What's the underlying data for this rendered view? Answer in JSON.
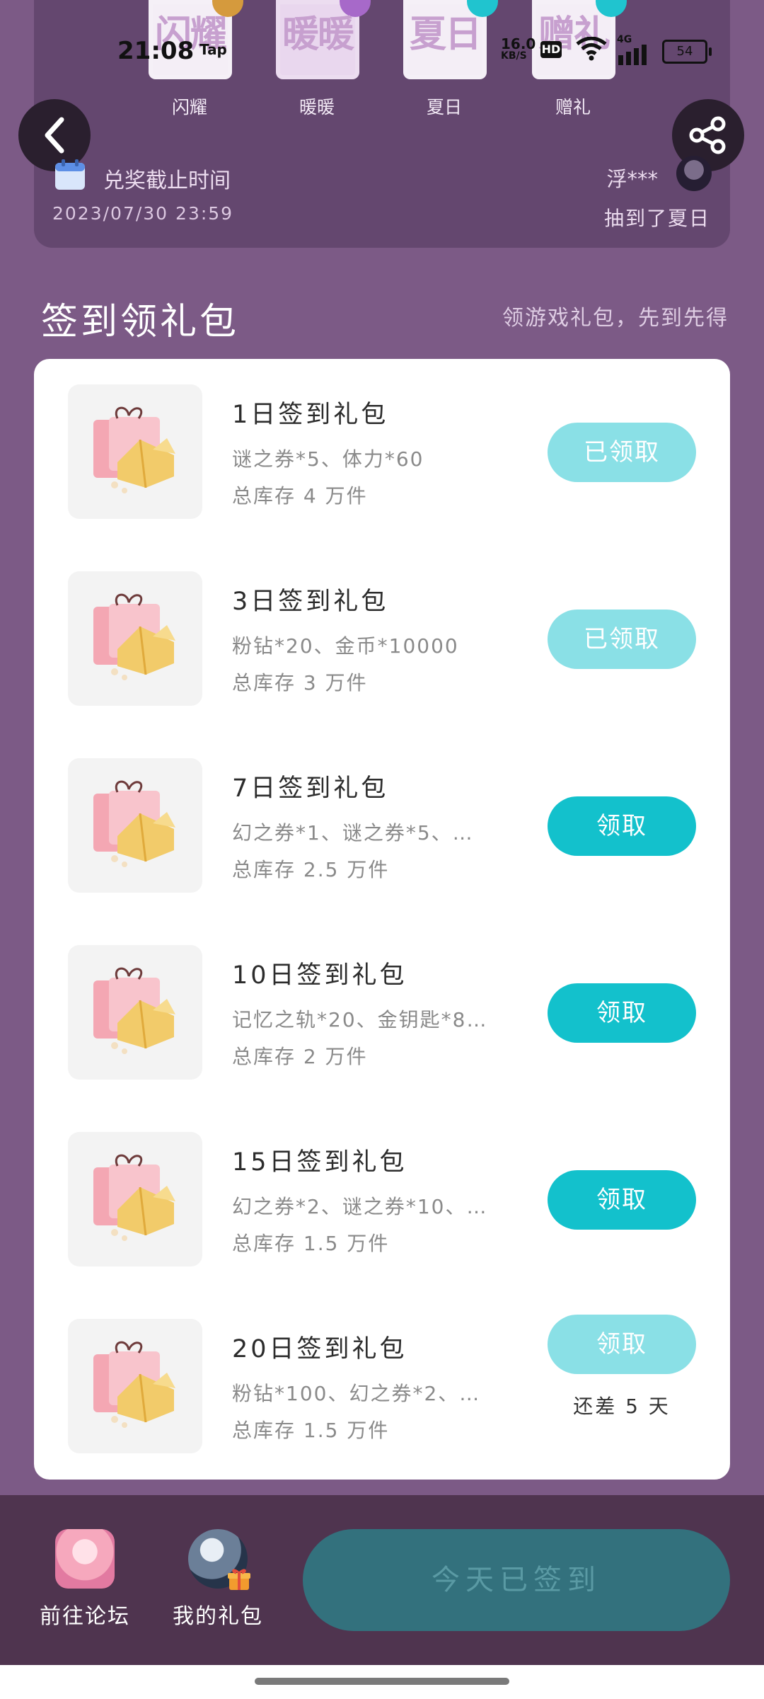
{
  "status_bar": {
    "time": "21:08",
    "tap_label": "Tap",
    "net_speed": "16.0",
    "net_unit": "KB/S",
    "hd": "HD",
    "network": "4G",
    "battery": "54"
  },
  "stamps": [
    {
      "big": "闪耀",
      "label": "闪耀",
      "corner_color": "#d59a3d"
    },
    {
      "big": "暖暖",
      "label": "暖暖",
      "corner_color": "#a769c9"
    },
    {
      "big": "夏日",
      "label": "夏日",
      "corner_color": "#20c4cf"
    },
    {
      "big": "赠礼",
      "label": "赠礼",
      "corner_color": "#20c4cf"
    }
  ],
  "redeem": {
    "label": "兑奖截止时间",
    "date": "2023/07/30 23:59"
  },
  "winner": {
    "name": "浮***",
    "prize": "抽到了夏日"
  },
  "section": {
    "title": "签到领礼包",
    "subtitle": "领游戏礼包，先到先得"
  },
  "packages": [
    {
      "name": "1日签到礼包",
      "items": "谜之券*5、体力*60",
      "stock": "总库存 4 万件",
      "button": "已领取",
      "state": "done",
      "remaining": ""
    },
    {
      "name": "3日签到礼包",
      "items": "粉钻*20、金币*10000",
      "stock": "总库存 3 万件",
      "button": "已领取",
      "state": "done",
      "remaining": ""
    },
    {
      "name": "7日签到礼包",
      "items": "幻之券*1、谜之券*5、…",
      "stock": "总库存 2.5 万件",
      "button": "领取",
      "state": "active",
      "remaining": ""
    },
    {
      "name": "10日签到礼包",
      "items": "记忆之轨*20、金钥匙*8…",
      "stock": "总库存 2 万件",
      "button": "领取",
      "state": "active",
      "remaining": ""
    },
    {
      "name": "15日签到礼包",
      "items": "幻之券*2、谜之券*10、…",
      "stock": "总库存 1.5 万件",
      "button": "领取",
      "state": "active",
      "remaining": ""
    },
    {
      "name": "20日签到礼包",
      "items": "粉钻*100、幻之券*2、…",
      "stock": "总库存 1.5 万件",
      "button": "领取",
      "state": "done",
      "remaining": "还差 5 天"
    }
  ],
  "bottom": {
    "forum_label": "前往论坛",
    "mygift_label": "我的礼包",
    "signed_label": "今天已签到"
  },
  "colors": {
    "background": "#7c5a86",
    "accent": "#13c1cc",
    "accent_disabled": "#8ae0e6"
  }
}
